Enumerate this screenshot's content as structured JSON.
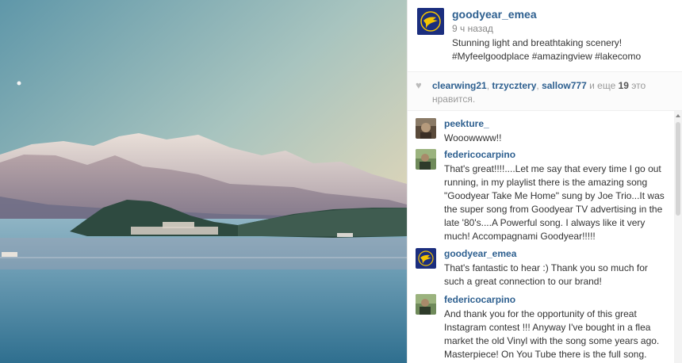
{
  "post": {
    "photo_icon": "lake-mountain-photo",
    "author": "goodyear_emea",
    "time": "9 ч назад",
    "caption_line1": "Stunning light and breathtaking scenery!",
    "caption_line2": "#Myfeelgoodplace #amazingview #lakecomo",
    "brand_color": "#1b2e7e",
    "brand_accent": "#f5c400"
  },
  "likes": {
    "icon": "heart-icon",
    "liker1": "clearwing21",
    "sep1": ", ",
    "liker2": "trzycztery",
    "sep2": ", ",
    "liker3": "sallow777",
    "and_more": " и еще ",
    "count": "19",
    "tail": " это нравится."
  },
  "comments": [
    {
      "author": "peekture_",
      "text": "Wooowwww!!"
    },
    {
      "author": "federicocarpino",
      "text": "That's great!!!!....Let me say that every time I go out running, in my playlist there is the amazing song \"Goodyear Take Me Home\" sung by Joe Trio...It was the super song from Goodyear TV advertising in the late '80's....A Powerful song. I always like it very much! Accompagnami Goodyear!!!!!"
    },
    {
      "author": "goodyear_emea",
      "text": "That's fantastic to hear :) Thank you so much for such a great connection to our brand!"
    },
    {
      "author": "federicocarpino",
      "text": "And thank you for the opportunity of this great Instagram contest !!! Anyway I've bought in a flea market the old Vinyl with the song some years ago. Masterpiece! On You Tube there is the full song."
    }
  ]
}
